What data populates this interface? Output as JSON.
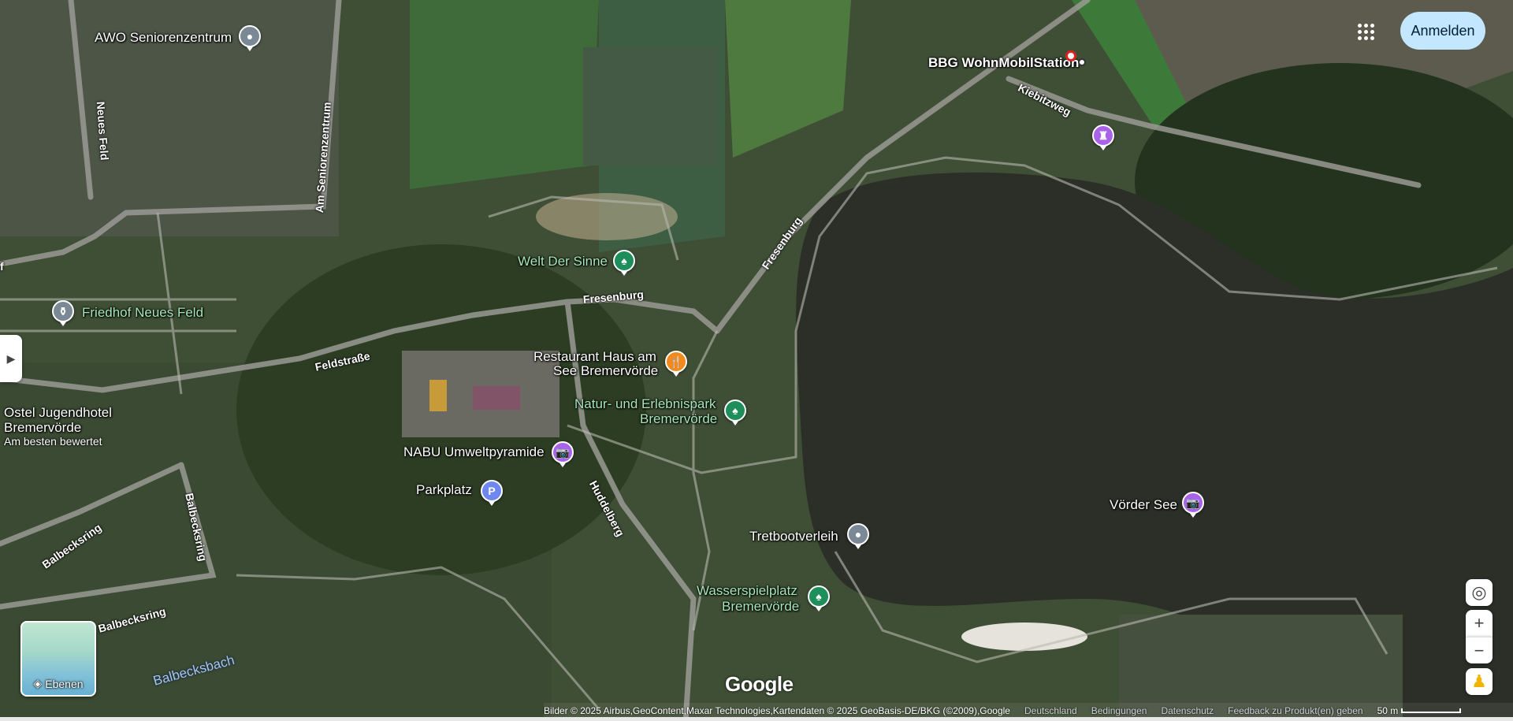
{
  "header": {
    "sign_in": "Anmelden",
    "apps_icon": "grid-apps-icon"
  },
  "places": {
    "awo": "AWO Seniorenzentrum",
    "bbg": "BBG WohnMobilStation",
    "welt_der_sinne": "Welt Der Sinne",
    "friedhof": "Friedhof Neues Feld",
    "restaurant_line1": "Restaurant Haus am",
    "restaurant_line2": "See Bremervörde",
    "natur_line1": "Natur- und Erlebnispark",
    "natur_line2": "Bremervörde",
    "ostel_line1": "Ostel Jugendhotel",
    "ostel_line2": "Bremervörde",
    "ostel_sub": "Am besten bewertet",
    "nabu": "NABU Umweltpyramide",
    "parkplatz": "Parkplatz",
    "tretboot": "Tretbootverleih",
    "voerder_see": "Vörder See",
    "wasser_line1": "Wasserspielplatz",
    "wasser_line2": "Bremervörde"
  },
  "roads": {
    "neues_feld": "Neues Feld",
    "am_seniorenzentrum": "Am Seniorenzentrum",
    "kiebitzweg": "Kiebitzweg",
    "fresenburg_a": "Fresenburg",
    "fresenburg_b": "Fresenburg",
    "feldstrasse": "Feldstraße",
    "huddelberg": "Huddelberg",
    "balbecksring_a": "Balbecksring",
    "balbecksring_b": "Balbecksring",
    "balbecksring_c": "Balbecksring",
    "balbecksbach": "Balbecksbach",
    "edge_f": "f"
  },
  "controls": {
    "layers": "Ebenen",
    "zoom_in": "+",
    "zoom_out": "−"
  },
  "branding": {
    "logo": "Google"
  },
  "footer": {
    "attribution": "Bilder © 2025 Airbus,GeoContent,Maxar Technologies,Kartendaten © 2025 GeoBasis-DE/BKG (©2009),Google",
    "country": "Deutschland",
    "terms": "Bedingungen",
    "privacy": "Datenschutz",
    "feedback": "Feedback zu Produkt(en) geben",
    "scale": "50 m"
  },
  "colors": {
    "signin_bg": "#c2e7ff",
    "water": "#2b2f27",
    "park_label": "#a5e7b8",
    "pin_grey": "#7b8896",
    "pin_green": "#1e8e5a",
    "pin_purple": "#a963e8",
    "pin_orange": "#f28a1d",
    "pin_blue": "#6f88f0"
  }
}
